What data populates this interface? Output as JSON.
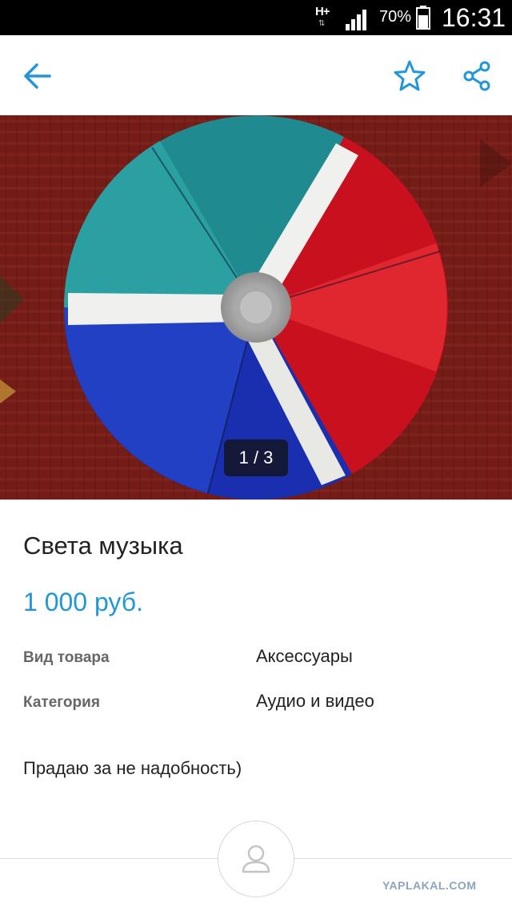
{
  "status_bar": {
    "network": "H+",
    "battery_percent": "70%",
    "time": "16:31",
    "battery_level": 0.7,
    "signal_bars": 4
  },
  "app_bar": {
    "back_icon": "arrow-left-icon",
    "favorite_icon": "star-outline-icon",
    "share_icon": "share-icon",
    "accent_color": "#2196d9"
  },
  "gallery": {
    "counter": "1 / 3",
    "image_subject": "rotating color wheel lamp (blue, red, cyan)"
  },
  "listing": {
    "title": "Света музыка",
    "price": "1 000 руб.",
    "attributes": [
      {
        "label": "Вид товара",
        "value": "Аксессуары"
      },
      {
        "label": "Категория",
        "value": "Аудио и видео"
      }
    ],
    "description": "Прадаю за не надобность)"
  },
  "seller": {
    "avatar_icon": "user-icon"
  },
  "watermark": "YAPLAKAL.COM"
}
